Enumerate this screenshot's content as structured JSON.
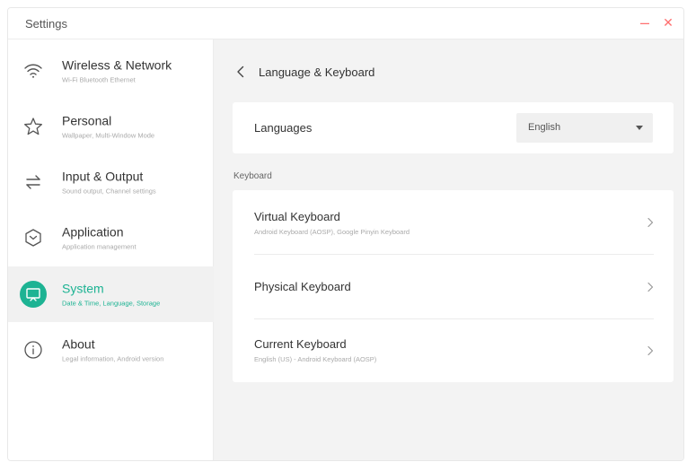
{
  "window": {
    "title": "Settings",
    "minimize_glyph": "–",
    "close_glyph": "✕",
    "accent_color": "#1db393"
  },
  "sidebar": {
    "items": [
      {
        "label": "Wireless & Network",
        "sub": "Wi-Fi Bluetooth Ethernet",
        "icon": "wifi-icon",
        "active": false
      },
      {
        "label": "Personal",
        "sub": "Wallpaper, Multi-Window Mode",
        "icon": "star-icon",
        "active": false
      },
      {
        "label": "Input & Output",
        "sub": "Sound output, Channel settings",
        "icon": "swap-arrows-icon",
        "active": false
      },
      {
        "label": "Application",
        "sub": "Application management",
        "icon": "hexagon-chevron-icon",
        "active": false
      },
      {
        "label": "System",
        "sub": "Date & Time, Language, Storage",
        "icon": "monitor-icon",
        "active": true
      },
      {
        "label": "About",
        "sub": "Legal information, Android version",
        "icon": "info-icon",
        "active": false
      }
    ]
  },
  "main": {
    "page_title": "Language & Keyboard",
    "languages": {
      "label": "Languages",
      "selected": "English"
    },
    "keyboard_section_label": "Keyboard",
    "keyboard_rows": [
      {
        "title": "Virtual Keyboard",
        "sub": "Android Keyboard (AOSP), Google Pinyin Keyboard"
      },
      {
        "title": "Physical Keyboard",
        "sub": ""
      },
      {
        "title": "Current Keyboard",
        "sub": "English (US) - Android Keyboard (AOSP)"
      }
    ]
  }
}
